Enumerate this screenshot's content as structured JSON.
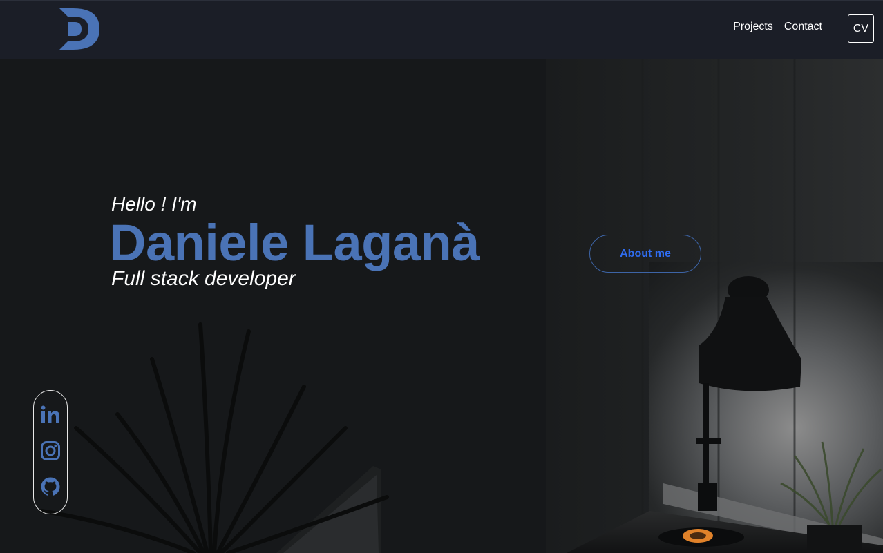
{
  "header": {
    "logo_letter": "D",
    "nav": [
      {
        "label": "Projects"
      },
      {
        "label": "Contact"
      }
    ],
    "cv_label": "CV"
  },
  "hero": {
    "greeting": "Hello ! I'm",
    "name": "Daniele Laganà",
    "role": "Full stack developer",
    "about_button": "About me"
  },
  "socials": [
    {
      "icon": "linkedin-icon"
    },
    {
      "icon": "instagram-icon"
    },
    {
      "icon": "github-icon"
    }
  ],
  "colors": {
    "accent": "#4a73b6",
    "button_text": "#2f6cf0",
    "header_bg": "#1b1e27",
    "page_bg": "#141618"
  }
}
